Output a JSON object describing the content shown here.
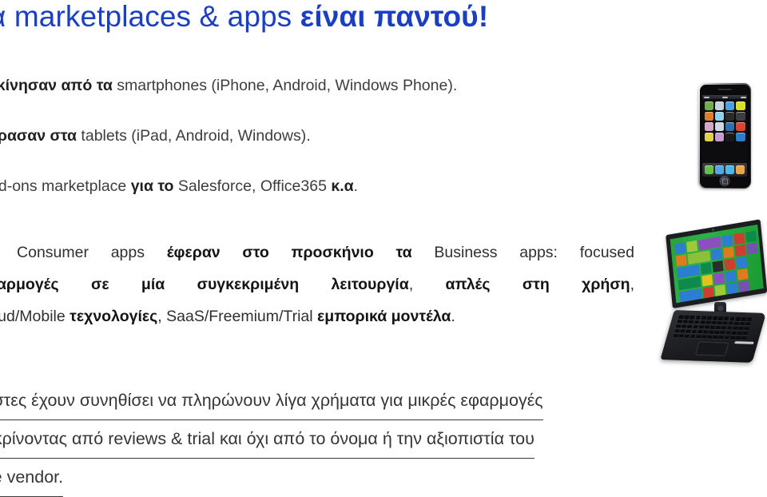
{
  "slide": {
    "title": {
      "regular_1": "α marketplaces & apps ",
      "bold_1": "είναι παντού!"
    },
    "bullets": [
      {
        "bold_1": "Ξεκίνησαν από τα",
        "regular_1": " smartphones (iPhone, Android, Windows Phone)."
      },
      {
        "bold_1": "Πέρασαν στα",
        "regular_1": " tablets (iPad, Android, Windows)."
      },
      {
        "regular_1": "Add-ons marketplace ",
        "bold_1": "για το",
        "regular_2": " Salesforce, Office365 ",
        "bold_2": "κ.α",
        "regular_3": "."
      }
    ],
    "middle_paragraph": {
      "line_1": {
        "regular_1": "α Consumer apps ",
        "bold_1": "έφεραν στο προσκήνιο τα",
        "regular_2": " Business apps: focused"
      },
      "line_2": {
        "bold_1": "φαρμογές σε μία συγκεκριμένη λειτουργία",
        "regular_1": ", ",
        "bold_2": "απλές στη χρήση",
        "regular_2": ","
      },
      "line_3": {
        "regular_1": "loud/Mobile ",
        "bold_1": "τεχνολογίες",
        "regular_2": ", SaaS/Freemium/Trial ",
        "bold_2": "εμπορικά μοντέλα",
        "regular_3": "."
      }
    },
    "bottom_paragraph": {
      "line_1": "χρήστες έχουν συνηθίσει να πληρώνουν λίγα χρήματα για μικρές εφαρμογές",
      "line_2": "ps) κρίνοντας από reviews & trial και όχι από το όνομα ή την αξιοπιστία του",
      "line_3": "ware vendor."
    },
    "images": {
      "phone": {
        "name": "iphone-3gs-photo",
        "app_icon_colors": [
          "#6fae4a",
          "#c8d2dc",
          "#4aa3e0",
          "#d9df2a",
          "#e07b2a",
          "#8ad3ea",
          "#2a2a2a",
          "#3e3e3e",
          "#d8a4c8",
          "#cfd8e0",
          "#2f6fb0",
          "#d7462f",
          "#e3cf4a",
          "#c99ad2",
          "#1a1a1a",
          "#2c7fc4"
        ],
        "dock_icon_colors": [
          "#65c04a",
          "#4fa8e8",
          "#4ab8e8",
          "#e8a54a"
        ]
      },
      "laptop": {
        "name": "windows8-convertible-tablet-photo",
        "start_screen_accent": "#27a23a",
        "tile_colors": [
          "#2d7dd2",
          "#9fc93c",
          "#8d4fbf",
          "#2d7dd2",
          "#cf3d2e",
          "#0f8a4d",
          "#e07a1f",
          "#8dbf3a",
          "#2d7dd2",
          "#e07a1f",
          "#cf3d2e",
          "#7a4fb5",
          "#2d7dd2",
          "#0f8a4d",
          "#2d2d2d",
          "#cf3d2e",
          "#2d7dd2",
          "#0f8a4d",
          "#e0c31f",
          "#8d4fbf",
          "#2d7dd2",
          "#e07a1f",
          "#2d7dd2",
          "#cf3d2e",
          "#9fc93c",
          "#2d7dd2",
          "#7a4fb5",
          "#0f8a4d"
        ]
      }
    },
    "colors": {
      "title": "#1b3fc2",
      "body_text": "#3d3d3d",
      "bold_text": "#141414",
      "background": "#ffffff"
    }
  }
}
